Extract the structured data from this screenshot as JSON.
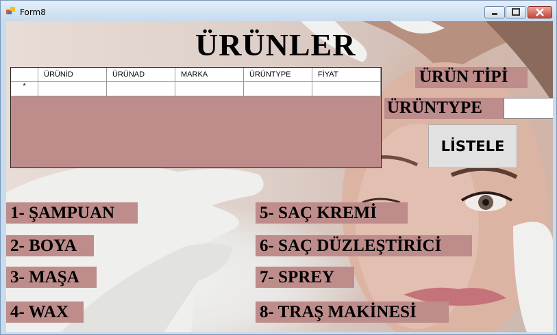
{
  "window": {
    "title": "Form8",
    "min_symbol": "—",
    "max_symbol": "▢",
    "close_symbol": "✕"
  },
  "form": {
    "heading": "ÜRÜNLER",
    "grid": {
      "columns": [
        "ÜRÜNİD",
        "ÜRÜNAD",
        "MARKA",
        "ÜRÜNTYPE",
        "FİYAT"
      ],
      "new_row_marker": "*"
    },
    "urun_tipi_label": "ÜRÜN TİPİ",
    "uruntype_label": "ÜRÜNTYPE",
    "uruntype_value": "",
    "list_button": "LİSTELE",
    "categories_left": [
      "1- ŞAMPUAN",
      "2- BOYA",
      "3- MAŞA",
      "4- WAX"
    ],
    "categories_right": [
      "5- SAÇ KREMİ",
      "6- SAÇ DÜZLEŞTİRİCİ",
      "7- SPREY",
      "8- TRAŞ MAKİNESİ"
    ]
  },
  "colors": {
    "label_bg": "#bd8c8b",
    "grid_bg": "#bd8c8b",
    "title_bar": "#c7dbef"
  }
}
